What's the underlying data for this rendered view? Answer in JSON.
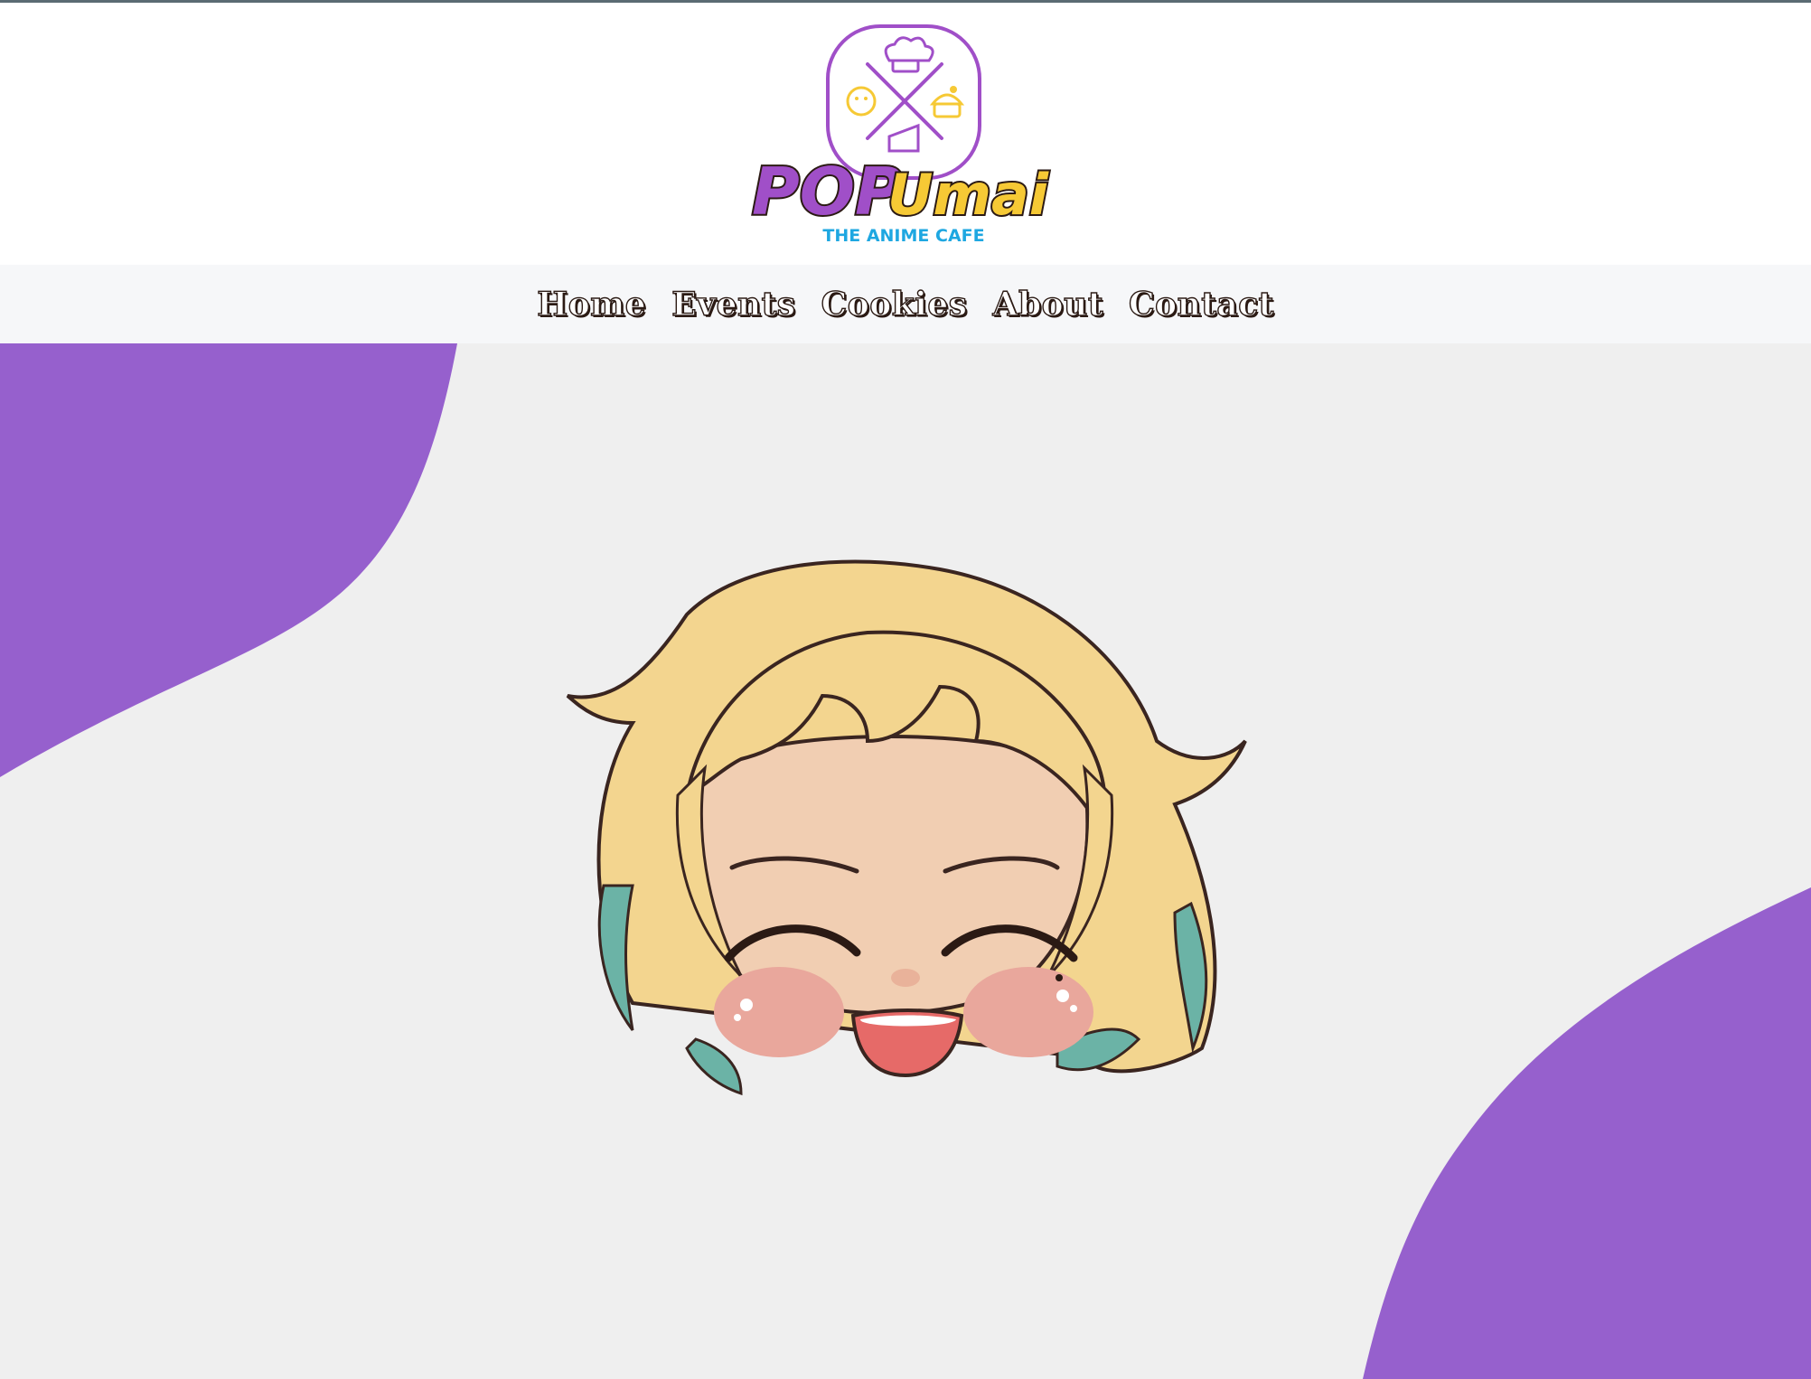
{
  "brand": {
    "logo_name": "POPUmai",
    "logo_pop": "POP",
    "logo_umai": "Umai",
    "tagline": "THE ANIME CAFE"
  },
  "nav": {
    "items": [
      {
        "label": "Home"
      },
      {
        "label": "Events"
      },
      {
        "label": "Cookies"
      },
      {
        "label": "About"
      },
      {
        "label": "Contact"
      }
    ]
  },
  "colors": {
    "accent_purple": "#9660cd",
    "brand_yellow": "#f6c935",
    "tagline_blue": "#1ea7e1",
    "hero_background": "#efefef"
  },
  "hero": {
    "image": "chibi-character-face-icon"
  }
}
